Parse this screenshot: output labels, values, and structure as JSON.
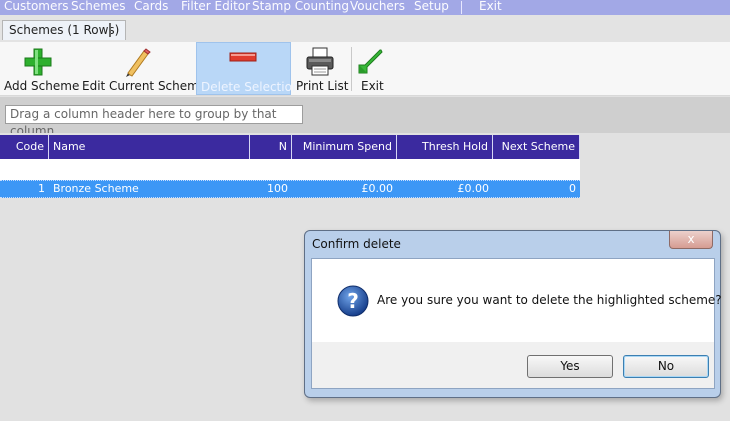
{
  "menu": {
    "items": [
      "Customers",
      "Schemes",
      "Cards",
      "Filter Editor",
      "Stamp Counting",
      "Vouchers",
      "Setup",
      "Exit"
    ]
  },
  "tab": {
    "label": "Schemes (1 Rows)"
  },
  "toolbar": {
    "add": "Add Scheme",
    "edit": "Edit Current Scheme",
    "delete": "Delete Selection",
    "print": "Print List",
    "exit": "Exit"
  },
  "groupby": {
    "hint": "Drag a column header here to group by that column."
  },
  "grid": {
    "columns": [
      "Code",
      "Name",
      "N",
      "Minimum Spend",
      "Thresh Hold",
      "Next Scheme"
    ],
    "rows": [
      {
        "code": "1",
        "name": "Bronze Scheme",
        "n": "100",
        "min_spend": "£0.00",
        "thresh_hold": "£0.00",
        "next_scheme": "0"
      }
    ]
  },
  "dialog": {
    "title": "Confirm delete",
    "message": "Are you sure you want to delete the highlighted scheme?",
    "yes": "Yes",
    "no": "No",
    "close": "x"
  },
  "colors": {
    "menubar": "#a2a8e6",
    "grid_header": "#3b2a9f",
    "selected_row": "#3c97f6",
    "selected_tool": "#b9d7f7"
  }
}
